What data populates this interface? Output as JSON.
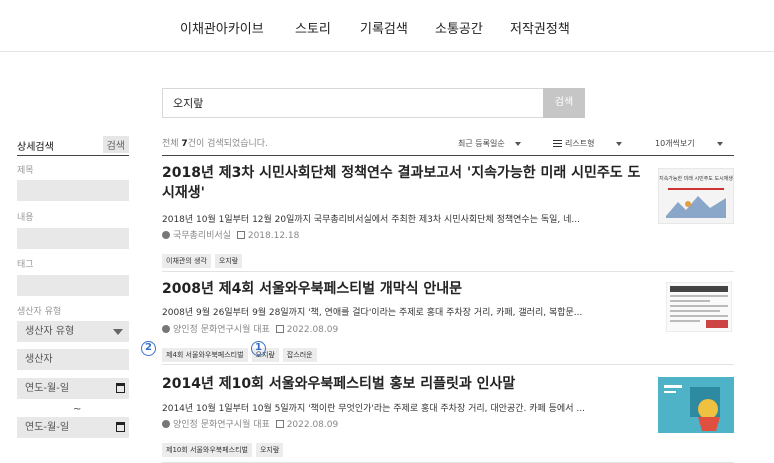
{
  "nav": [
    "이채관아카이브",
    "스토리",
    "기록검색",
    "소통공간",
    "저작권정책"
  ],
  "search": {
    "value": "오지랖",
    "button": "검색"
  },
  "sidebar": {
    "title": "상세검색",
    "search_button": "검색",
    "labels": {
      "title": "제목",
      "content": "내용",
      "tag": "태그",
      "producer_type": "생산자 유형"
    },
    "producer_type_select": "생산자 유형",
    "producer_placeholder": "생산자",
    "date_from": "연도-월-일",
    "date_to": "연도-월-일",
    "tilde": "~"
  },
  "list": {
    "count_prefix": "전체 ",
    "count": "7",
    "count_suffix": "건이 검색되었습니다.",
    "sort": "최근 등록일순",
    "view": "리스트형",
    "per_page": "10개씩보기"
  },
  "results": [
    {
      "title": "2018년 제3차 시민사회단체 정책연수 결과보고서 '지속가능한 미래 시민주도 도시재생'",
      "desc": "2018년 10월 1일부터 12월 20일까지 국무총리비서실에서 주최한 제3차 시민사회단체 정책연수는 독일, 네...",
      "author": "국무총리비서실",
      "date": "2018.12.18",
      "tags": [
        "이채관의 생각",
        "오지랖"
      ],
      "thumb_text": "지속가능한 미래 시민주도 도시재생"
    },
    {
      "title": "2008년 제4회 서울와우북페스티벌 개막식 안내문",
      "desc": "2008년 9월 26일부터 9월 28일까지 '책, 연애를 걸다'이라는 주제로 홍대 주차장 거리, 카페, 갤러리, 복합문...",
      "author": "양인정 문화연구시월 대표",
      "date": "2022.08.09",
      "tags": [
        "제4회 서울와우북페스티벌",
        "오지랖",
        "잡스러운"
      ]
    },
    {
      "title": "2014년 제10회 서울와우북페스티벌 홍보 리플릿과 인사말",
      "desc": "2014년 10월 1일부터 10월 5일까지 '책이란 무엇인가'라는 주제로 홍대 주차장 거리, 대안공간. 카페 등에서 ...",
      "author": "양인정 문화연구시월 대표",
      "date": "2022.08.09",
      "tags": [
        "제10회 서울와우북페스티벌",
        "오지랖"
      ]
    }
  ],
  "markers": [
    "1",
    "2"
  ],
  "colors": {
    "marker": "#3a6fc9",
    "thumb3": "#4fb3c8"
  }
}
